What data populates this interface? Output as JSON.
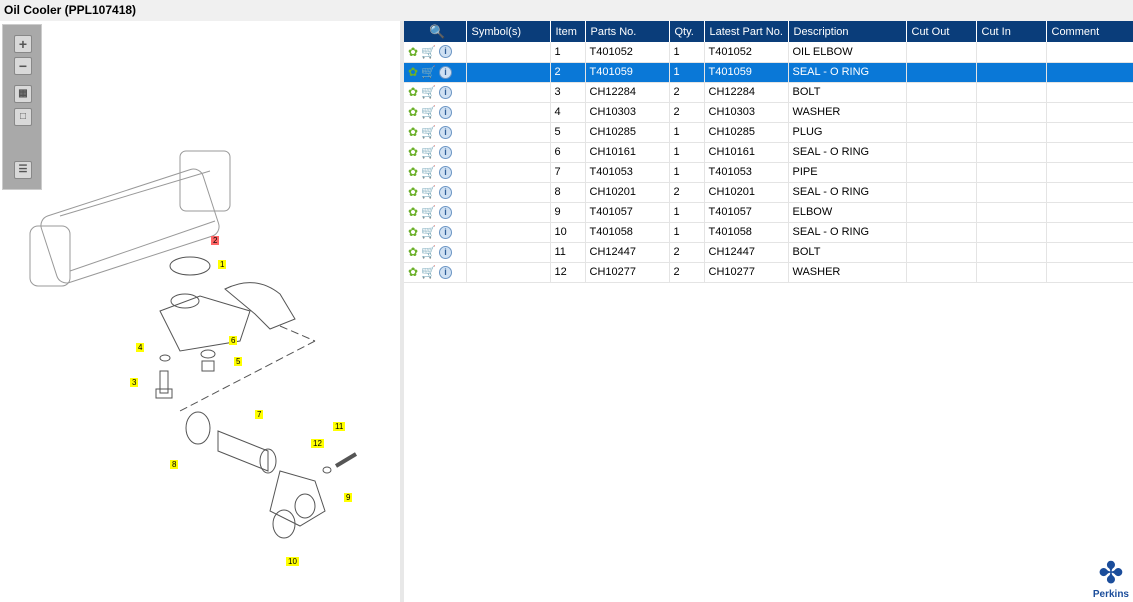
{
  "title": "Oil Cooler (PPL107418)",
  "toolbar": {
    "zoom_in": "+",
    "zoom_out": "−"
  },
  "callouts": [
    {
      "n": "2",
      "selected": true
    },
    {
      "n": "1"
    },
    {
      "n": "6"
    },
    {
      "n": "4"
    },
    {
      "n": "5"
    },
    {
      "n": "3"
    },
    {
      "n": "7"
    },
    {
      "n": "12"
    },
    {
      "n": "11"
    },
    {
      "n": "8"
    },
    {
      "n": "9"
    },
    {
      "n": "10"
    }
  ],
  "table": {
    "headers": [
      "Symbol(s)",
      "Item",
      "Parts No.",
      "Qty.",
      "Latest Part No.",
      "Description",
      "Cut Out",
      "Cut In",
      "Comment"
    ],
    "selected_item": "2",
    "rows": [
      [
        "",
        "1",
        "T401052",
        "1",
        "T401052",
        "OIL ELBOW",
        "",
        "",
        ""
      ],
      [
        "",
        "2",
        "T401059",
        "1",
        "T401059",
        "SEAL - O RING",
        "",
        "",
        ""
      ],
      [
        "",
        "3",
        "CH12284",
        "2",
        "CH12284",
        "BOLT",
        "",
        "",
        ""
      ],
      [
        "",
        "4",
        "CH10303",
        "2",
        "CH10303",
        "WASHER",
        "",
        "",
        ""
      ],
      [
        "",
        "5",
        "CH10285",
        "1",
        "CH10285",
        "PLUG",
        "",
        "",
        ""
      ],
      [
        "",
        "6",
        "CH10161",
        "1",
        "CH10161",
        "SEAL - O RING",
        "",
        "",
        ""
      ],
      [
        "",
        "7",
        "T401053",
        "1",
        "T401053",
        "PIPE",
        "",
        "",
        ""
      ],
      [
        "",
        "8",
        "CH10201",
        "2",
        "CH10201",
        "SEAL - O RING",
        "",
        "",
        ""
      ],
      [
        "",
        "9",
        "T401057",
        "1",
        "T401057",
        "ELBOW",
        "",
        "",
        ""
      ],
      [
        "",
        "10",
        "T401058",
        "1",
        "T401058",
        "SEAL - O RING",
        "",
        "",
        ""
      ],
      [
        "",
        "11",
        "CH12447",
        "2",
        "CH12447",
        "BOLT",
        "",
        "",
        ""
      ],
      [
        "",
        "12",
        "CH10277",
        "2",
        "CH10277",
        "WASHER",
        "",
        "",
        ""
      ]
    ]
  },
  "logo": {
    "text": "Perkins"
  },
  "colors": {
    "header": "#0a3d7a",
    "selected": "#0a78d7"
  }
}
